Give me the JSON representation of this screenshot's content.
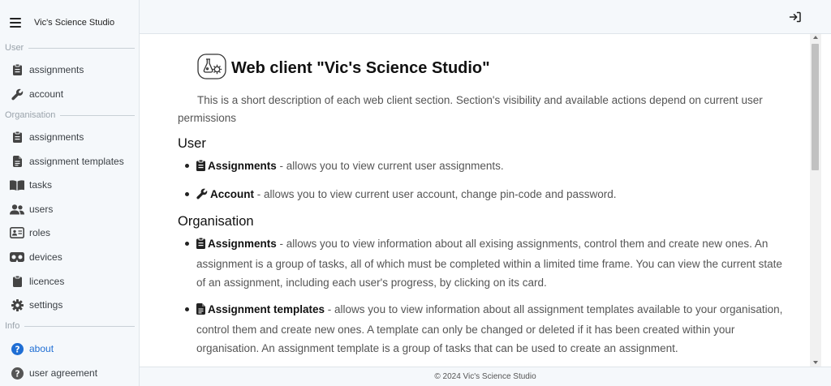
{
  "app": {
    "title": "Vic's Science Studio"
  },
  "sidebar": {
    "sections": {
      "user": "User",
      "organisation": "Organisation",
      "info": "Info"
    },
    "items": [
      {
        "label": "assignments",
        "icon": "clipboard-icon"
      },
      {
        "label": "account",
        "icon": "wrench-icon"
      },
      {
        "label": "assignments",
        "icon": "clipboard-icon"
      },
      {
        "label": "assignment templates",
        "icon": "file-lines-icon"
      },
      {
        "label": "tasks",
        "icon": "book-open-icon"
      },
      {
        "label": "users",
        "icon": "users-icon"
      },
      {
        "label": "roles",
        "icon": "id-card-icon"
      },
      {
        "label": "devices",
        "icon": "vr-headset-icon"
      },
      {
        "label": "licences",
        "icon": "clipboard-icon"
      },
      {
        "label": "settings",
        "icon": "gear-icon"
      },
      {
        "label": "about",
        "icon": "question-circle-icon",
        "active": true
      },
      {
        "label": "user agreement",
        "icon": "question-circle-icon"
      }
    ]
  },
  "colors": {
    "accent": "#1f6ed4",
    "sidebar_bg": "#f5f8fb"
  },
  "doc": {
    "title": "Web client \"Vic's Science Studio\"",
    "intro": "This is a short description of each web client section. Section's visibility and available actions depend on current user permissions",
    "user_heading": "User",
    "user_items": [
      {
        "title": "Assignments",
        "text": " - allows you to view current user assignments."
      },
      {
        "title": "Account",
        "text": " - allows you to view current user account, change pin-code and password."
      }
    ],
    "org_heading": "Organisation",
    "org_items": [
      {
        "title": "Assignments",
        "text": " - allows you to view information about all exising assignments, control them and create new ones. An assignment is a group of tasks, all of which must be completed within a limited time frame. You can view the current state of an assignment, including each user's progress, by clicking on its card."
      },
      {
        "title": "Assignment templates",
        "text": " - allows you to view information about all assignment templates available to your organisation, control them and create new ones. A template can only be changed or deleted if it has been created within your organisation. An assignment template is a group of tasks that can be used to create an assignment."
      }
    ]
  },
  "footer": {
    "text": "© 2024 Vic's Science Studio"
  }
}
